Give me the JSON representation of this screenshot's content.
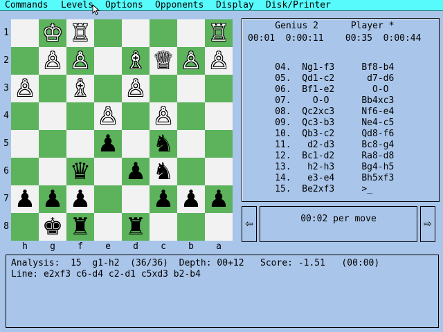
{
  "menu": [
    "Commands",
    "Levels",
    "Options",
    "Opponents",
    "Display",
    "Disk/Printer"
  ],
  "board": {
    "rank_labels": [
      "1",
      "2",
      "3",
      "4",
      "5",
      "6",
      "7",
      "8"
    ],
    "file_labels": [
      "h",
      "g",
      "f",
      "e",
      "d",
      "c",
      "b",
      "a"
    ],
    "rows": [
      [
        null,
        "wK",
        "wR",
        null,
        null,
        null,
        null,
        "wR"
      ],
      [
        null,
        "wP",
        "wP",
        null,
        "wB",
        "wQ",
        "wP",
        "wP"
      ],
      [
        "wP",
        null,
        "wB",
        null,
        "wP",
        null,
        null,
        null
      ],
      [
        null,
        null,
        null,
        "wP",
        null,
        "wP",
        null,
        null
      ],
      [
        null,
        null,
        null,
        "bP",
        null,
        "bN",
        null,
        null
      ],
      [
        null,
        null,
        "bQ",
        null,
        "bP",
        "bN",
        null,
        null
      ],
      [
        "bP",
        "bP",
        "bP",
        null,
        null,
        "bP",
        "bP",
        "bP"
      ],
      [
        null,
        "bK",
        "bR",
        null,
        "bR",
        null,
        null,
        null
      ]
    ],
    "glyphs": {
      "wK": "♔",
      "wQ": "♕",
      "wR": "♖",
      "wB": "♗",
      "wN": "♘",
      "wP": "♙",
      "bK": "♚",
      "bQ": "♛",
      "bR": "♜",
      "bB": "♝",
      "bN": "♞",
      "bP": "♟"
    },
    "colors": {
      "light": "#f2f2f2",
      "dark": "#5cb35c"
    }
  },
  "panel": {
    "header": "    Genius 2      Player *",
    "clocks": "00:01  0:00:11    00:35  0:00:44",
    "moves": [
      "     04.  Ng1-f3     Bf8-b4",
      "     05.  Qd1-c2      d7-d6",
      "     06.  Bf1-e2       O-O",
      "     07.    O-O      Bb4xc3",
      "     08.  Qc2xc3     Nf6-e4",
      "     09.  Qc3-b3     Ne4-c5",
      "     10.  Qb3-c2     Qd8-f6",
      "     11.   d2-d3     Bc8-g4",
      "     12.  Bc1-d2     Ra8-d8",
      "     13.   h2-h3     Bg4-h5",
      "     14.   e3-e4     Bh5xf3",
      "     15.  Be2xf3     >_"
    ]
  },
  "nav": {
    "left_icon": "⇦",
    "right_icon": "⇨"
  },
  "time_control": "00:02 per move",
  "analysis": {
    "line1": "Analysis:  15  g1-h2  (36/36)  Depth: 00+12   Score: -1.51   (00:00)",
    "line2": "Line: e2xf3 c6-d4 c2-d1 c5xd3 b2-b4"
  }
}
